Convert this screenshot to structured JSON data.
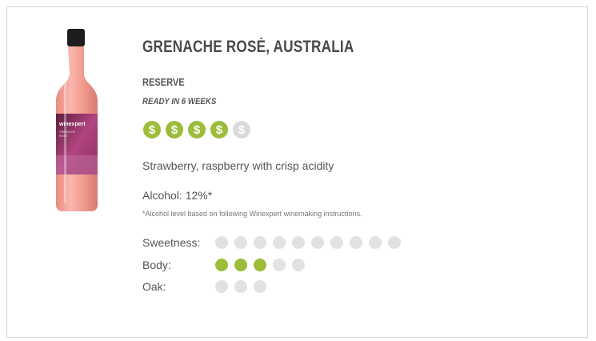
{
  "product": {
    "title": "GRENACHE ROSÉ, AUSTRALIA",
    "line": "RESERVE",
    "ready": "READY IN 6 WEEKS",
    "description": "Strawberry, raspberry with crisp acidity",
    "alcohol": "Alcohol: 12%*",
    "alcohol_note": "*Alcohol level based on following Winexpert winemaking instructions.",
    "bottle_label_brand": "winexpert",
    "bottle_label_name": "GRENACHE ROSÉ"
  },
  "price": {
    "symbol": "$",
    "level": 4,
    "max": 5
  },
  "scales": {
    "sweetness": {
      "label": "Sweetness:",
      "value": 0,
      "max": 10
    },
    "body": {
      "label": "Body:",
      "value": 3,
      "max": 5
    },
    "oak": {
      "label": "Oak:",
      "value": 0,
      "max": 3
    }
  },
  "colors": {
    "accent": "#9bbd3a",
    "inactive": "#e2e2e2",
    "text": "#555555",
    "bottle": "#f2a49b"
  }
}
